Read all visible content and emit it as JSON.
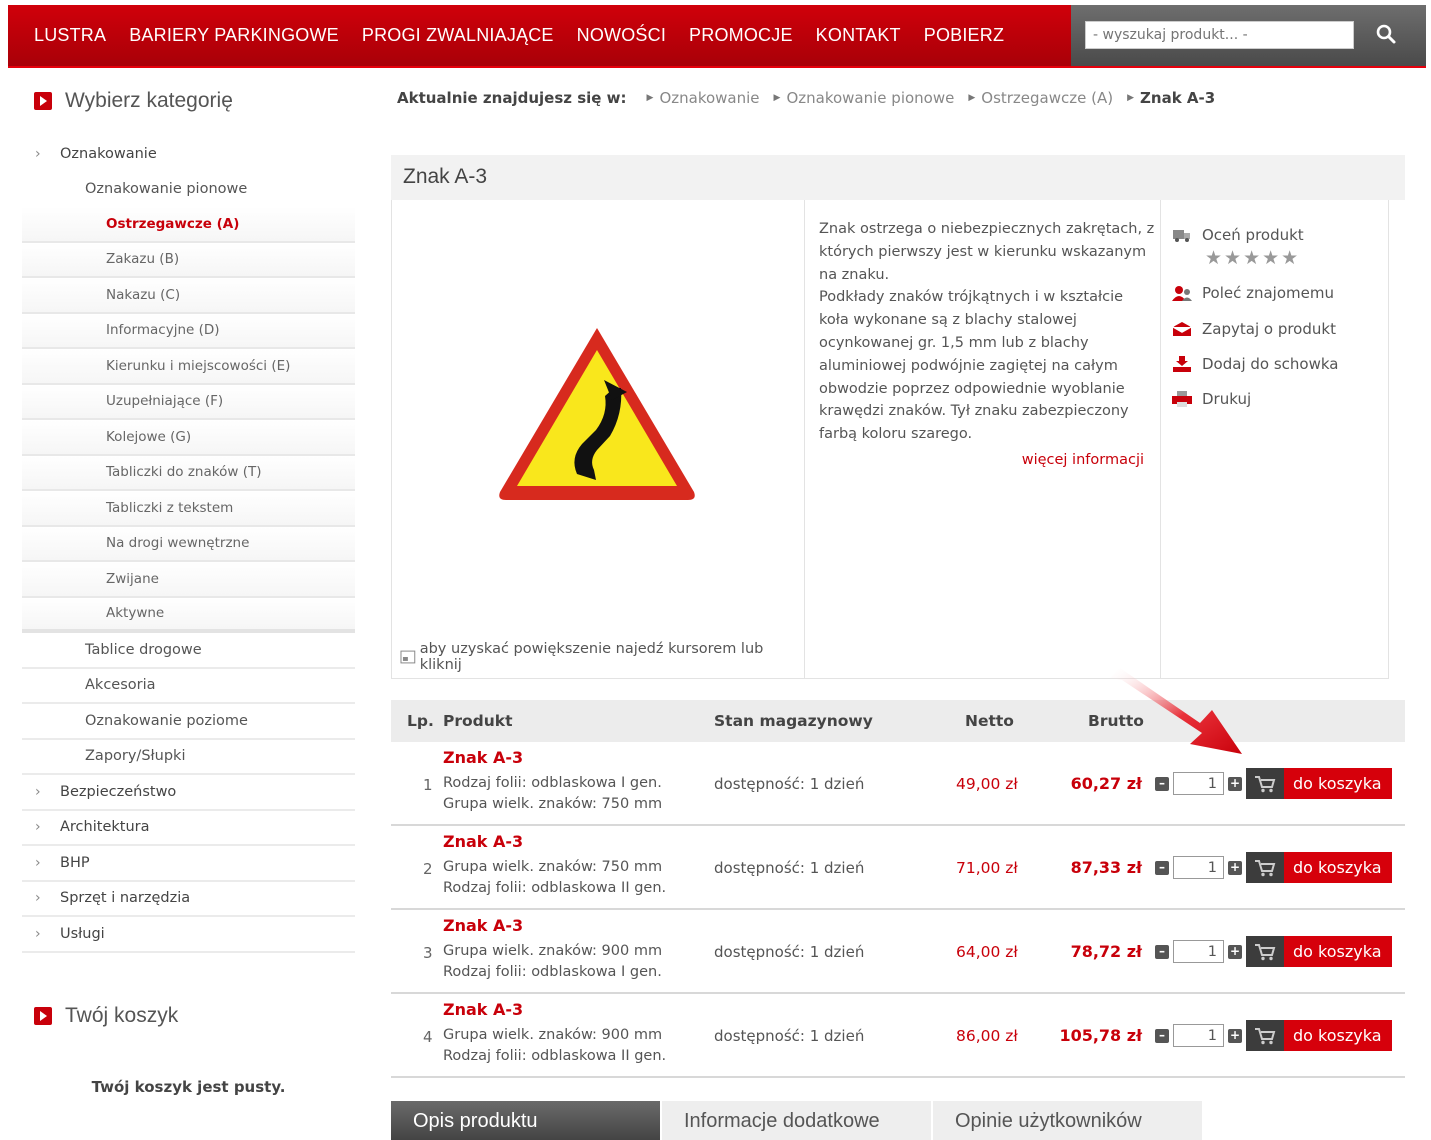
{
  "topnav": [
    "LUSTRA",
    "BARIERY PARKINGOWE",
    "PROGI ZWALNIAJĄCE",
    "NOWOŚCI",
    "PROMOCJE",
    "KONTAKT",
    "POBIERZ"
  ],
  "search": {
    "placeholder": "- wyszukaj produkt... -"
  },
  "sidebar": {
    "title": "Wybierz kategorię",
    "categories": [
      "Oznakowanie",
      "Oznakowanie pionowe",
      "Ostrzegawcze (A)",
      "Zakazu (B)",
      "Nakazu (C)",
      "Informacyjne (D)",
      "Kierunku i miejscowości (E)",
      "Uzupełniające (F)",
      "Kolejowe (G)",
      "Tabliczki do znaków (T)",
      "Tabliczki z tekstem",
      "Na drogi wewnętrzne",
      "Zwijane",
      "Aktywne",
      "Tablice drogowe",
      "Akcesoria",
      "Oznakowanie poziome",
      "Zapory/Słupki",
      "Bezpieczeństwo",
      "Architektura",
      "BHP",
      "Sprzęt i narzędzia",
      "Usługi"
    ],
    "cart_title": "Twój koszyk",
    "cart_empty": "Twój koszyk jest pusty."
  },
  "breadcrumb": {
    "lead": "Aktualnie znajdujesz się w:",
    "items": [
      "Oznakowanie",
      "Oznakowanie pionowe",
      "Ostrzegawcze (A)"
    ],
    "current": "Znak A-3"
  },
  "product": {
    "title": "Znak A-3",
    "zoom_hint": "aby uzyskać powiększenie najedź kursorem lub kliknij",
    "desc_lines": [
      "Znak ostrzega o niebezpiecznych zakrętach, z",
      "których pierwszy jest w kierunku wskazanym",
      "na znaku.",
      "Podkłady znaków trójkątnych i w kształcie",
      "koła wykonane są z blachy stalowej",
      "ocynkowanej gr. 1,5 mm lub z blachy",
      "aluminiowej podwójnie zagiętej na całym",
      "obwodzie poprzez odpowiednie wyoblanie",
      "krawędzi znaków. Tył znaku zabezpieczony",
      "farbą koloru szarego."
    ],
    "more": "więcej informacji",
    "rating": "★★★★★",
    "actions": [
      "Oceń produkt",
      "Poleć znajomemu",
      "Zapytaj o produkt",
      "Dodaj do schowka",
      "Drukuj"
    ]
  },
  "table": {
    "headers": {
      "lp": "Lp.",
      "product": "Produkt",
      "stock": "Stan magazynowy",
      "net": "Netto",
      "gross": "Brutto"
    },
    "rows": [
      {
        "lp": "1",
        "name": "Znak A-3",
        "v1": "Rodzaj folii: odblaskowa I gen.",
        "v2": "Grupa wielk. znaków: 750 mm",
        "stock": "dostępność: 1 dzień",
        "net": "49,00 zł",
        "gross": "60,27 zł",
        "qty": "1",
        "btn": "do koszyka"
      },
      {
        "lp": "2",
        "name": "Znak A-3",
        "v1": "Grupa wielk. znaków: 750 mm",
        "v2": "Rodzaj folii: odblaskowa II gen.",
        "stock": "dostępność: 1 dzień",
        "net": "71,00 zł",
        "gross": "87,33 zł",
        "qty": "1",
        "btn": "do koszyka"
      },
      {
        "lp": "3",
        "name": "Znak A-3",
        "v1": "Grupa wielk. znaków: 900 mm",
        "v2": "Rodzaj folii: odblaskowa I gen.",
        "stock": "dostępność: 1 dzień",
        "net": "64,00 zł",
        "gross": "78,72 zł",
        "qty": "1",
        "btn": "do koszyka"
      },
      {
        "lp": "4",
        "name": "Znak A-3",
        "v1": "Grupa wielk. znaków: 900 mm",
        "v2": "Rodzaj folii: odblaskowa II gen.",
        "stock": "dostępność: 1 dzień",
        "net": "86,00 zł",
        "gross": "105,78 zł",
        "qty": "1",
        "btn": "do koszyka"
      }
    ]
  },
  "tabs": [
    "Opis produktu",
    "Informacje dodatkowe",
    "Opinie użytkowników"
  ],
  "colors": {
    "brand": "#c8000a",
    "dark": "#444444"
  }
}
